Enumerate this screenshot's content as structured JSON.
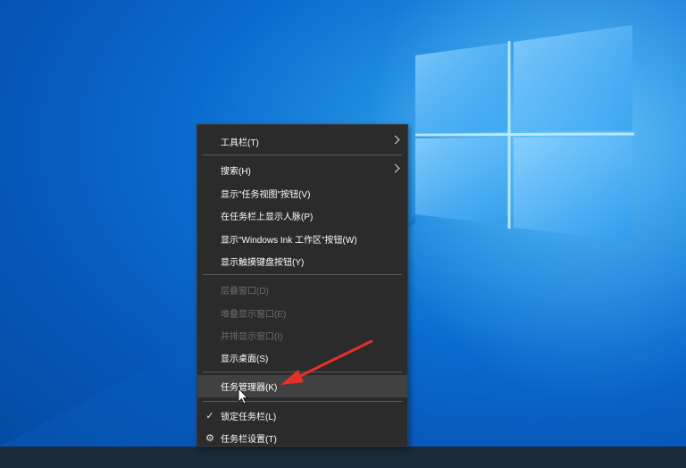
{
  "context_menu": {
    "items": [
      {
        "label": "工具栏(T)",
        "has_submenu": true,
        "enabled": true
      },
      {
        "label": "搜索(H)",
        "has_submenu": true,
        "enabled": true
      },
      {
        "label": "显示\"任务视图\"按钮(V)",
        "enabled": true
      },
      {
        "label": "在任务栏上显示人脉(P)",
        "enabled": true
      },
      {
        "label": "显示\"Windows Ink 工作区\"按钮(W)",
        "enabled": true
      },
      {
        "label": "显示触摸键盘按钮(Y)",
        "enabled": true
      },
      {
        "label": "层叠窗口(D)",
        "enabled": false
      },
      {
        "label": "堆叠显示窗口(E)",
        "enabled": false
      },
      {
        "label": "并排显示窗口(I)",
        "enabled": false
      },
      {
        "label": "显示桌面(S)",
        "enabled": true
      },
      {
        "label": "任务管理器(K)",
        "enabled": true,
        "highlighted": true
      },
      {
        "label": "锁定任务栏(L)",
        "enabled": true,
        "checked": true,
        "icon": "checkmark-icon"
      },
      {
        "label": "任务栏设置(T)",
        "enabled": true,
        "icon": "gear-icon"
      }
    ]
  },
  "colors": {
    "menu_bg": "#2b2b2b",
    "highlight_bg": "#414141",
    "disabled_text": "#6d6d6d",
    "annotation_arrow": "#e8302a"
  }
}
